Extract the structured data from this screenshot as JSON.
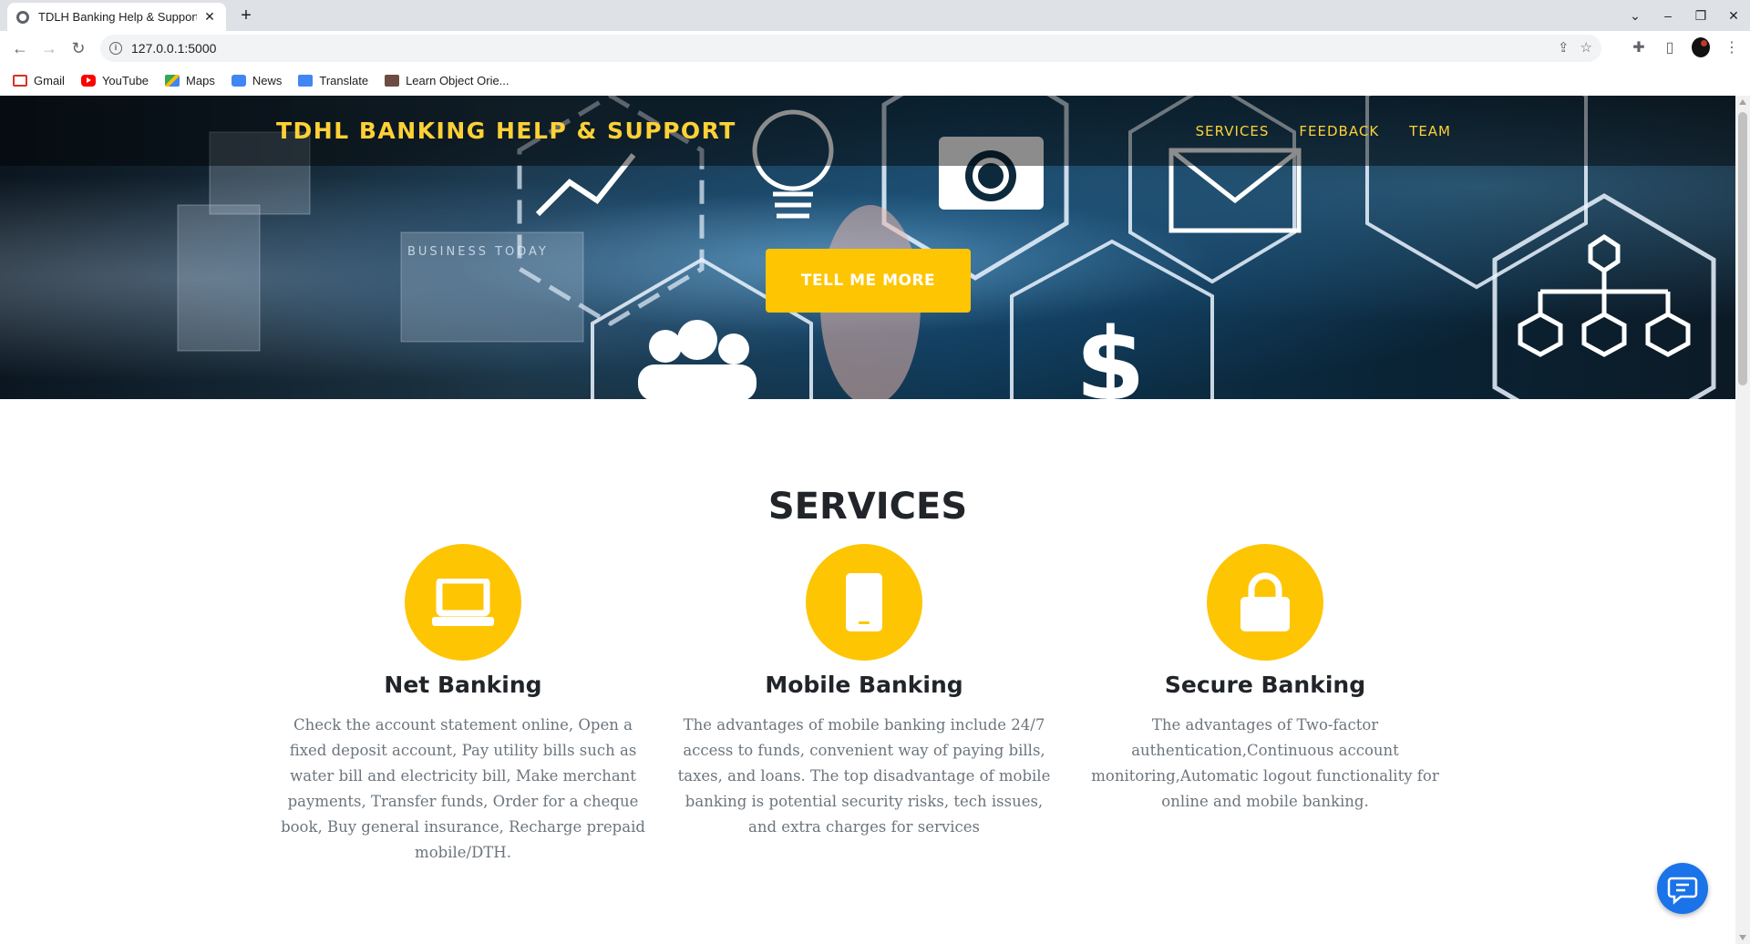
{
  "browser": {
    "tab_title": "TDLH Banking Help & Support",
    "url": "127.0.0.1:5000",
    "bookmarks": [
      "Gmail",
      "YouTube",
      "Maps",
      "News",
      "Translate",
      "Learn Object Orie..."
    ]
  },
  "hero": {
    "brand": "TDHL BANKING HELP & SUPPORT",
    "nav": [
      "SERVICES",
      "FEEDBACK",
      "TEAM"
    ],
    "cta_label": "TELL ME MORE",
    "background_art_texts": [
      "BUSINESS TODAY"
    ]
  },
  "services": {
    "title": "SERVICES",
    "items": [
      {
        "icon": "laptop-icon",
        "name": "Net Banking",
        "description": "Check the account statement online, Open a fixed deposit account, Pay utility bills such as water bill and electricity bill, Make merchant payments, Transfer funds, Order for a cheque book, Buy general insurance, Recharge prepaid mobile/DTH."
      },
      {
        "icon": "mobile-phone-icon",
        "name": "Mobile Banking",
        "description": "The advantages of mobile banking include 24/7 access to funds, convenient way of paying bills, taxes, and loans. The top disadvantage of mobile banking is potential security risks, tech issues, and extra charges for services"
      },
      {
        "icon": "lock-icon",
        "name": "Secure Banking",
        "description": "The advantages of Two-factor authentication,Continuous account monitoring,Automatic logout functionality for online and mobile banking."
      }
    ]
  },
  "colors": {
    "accent": "#fec503",
    "brand_text": "#fed136",
    "heading": "#212529",
    "body_text": "#6c757d",
    "chat_button": "#1a73e8"
  }
}
